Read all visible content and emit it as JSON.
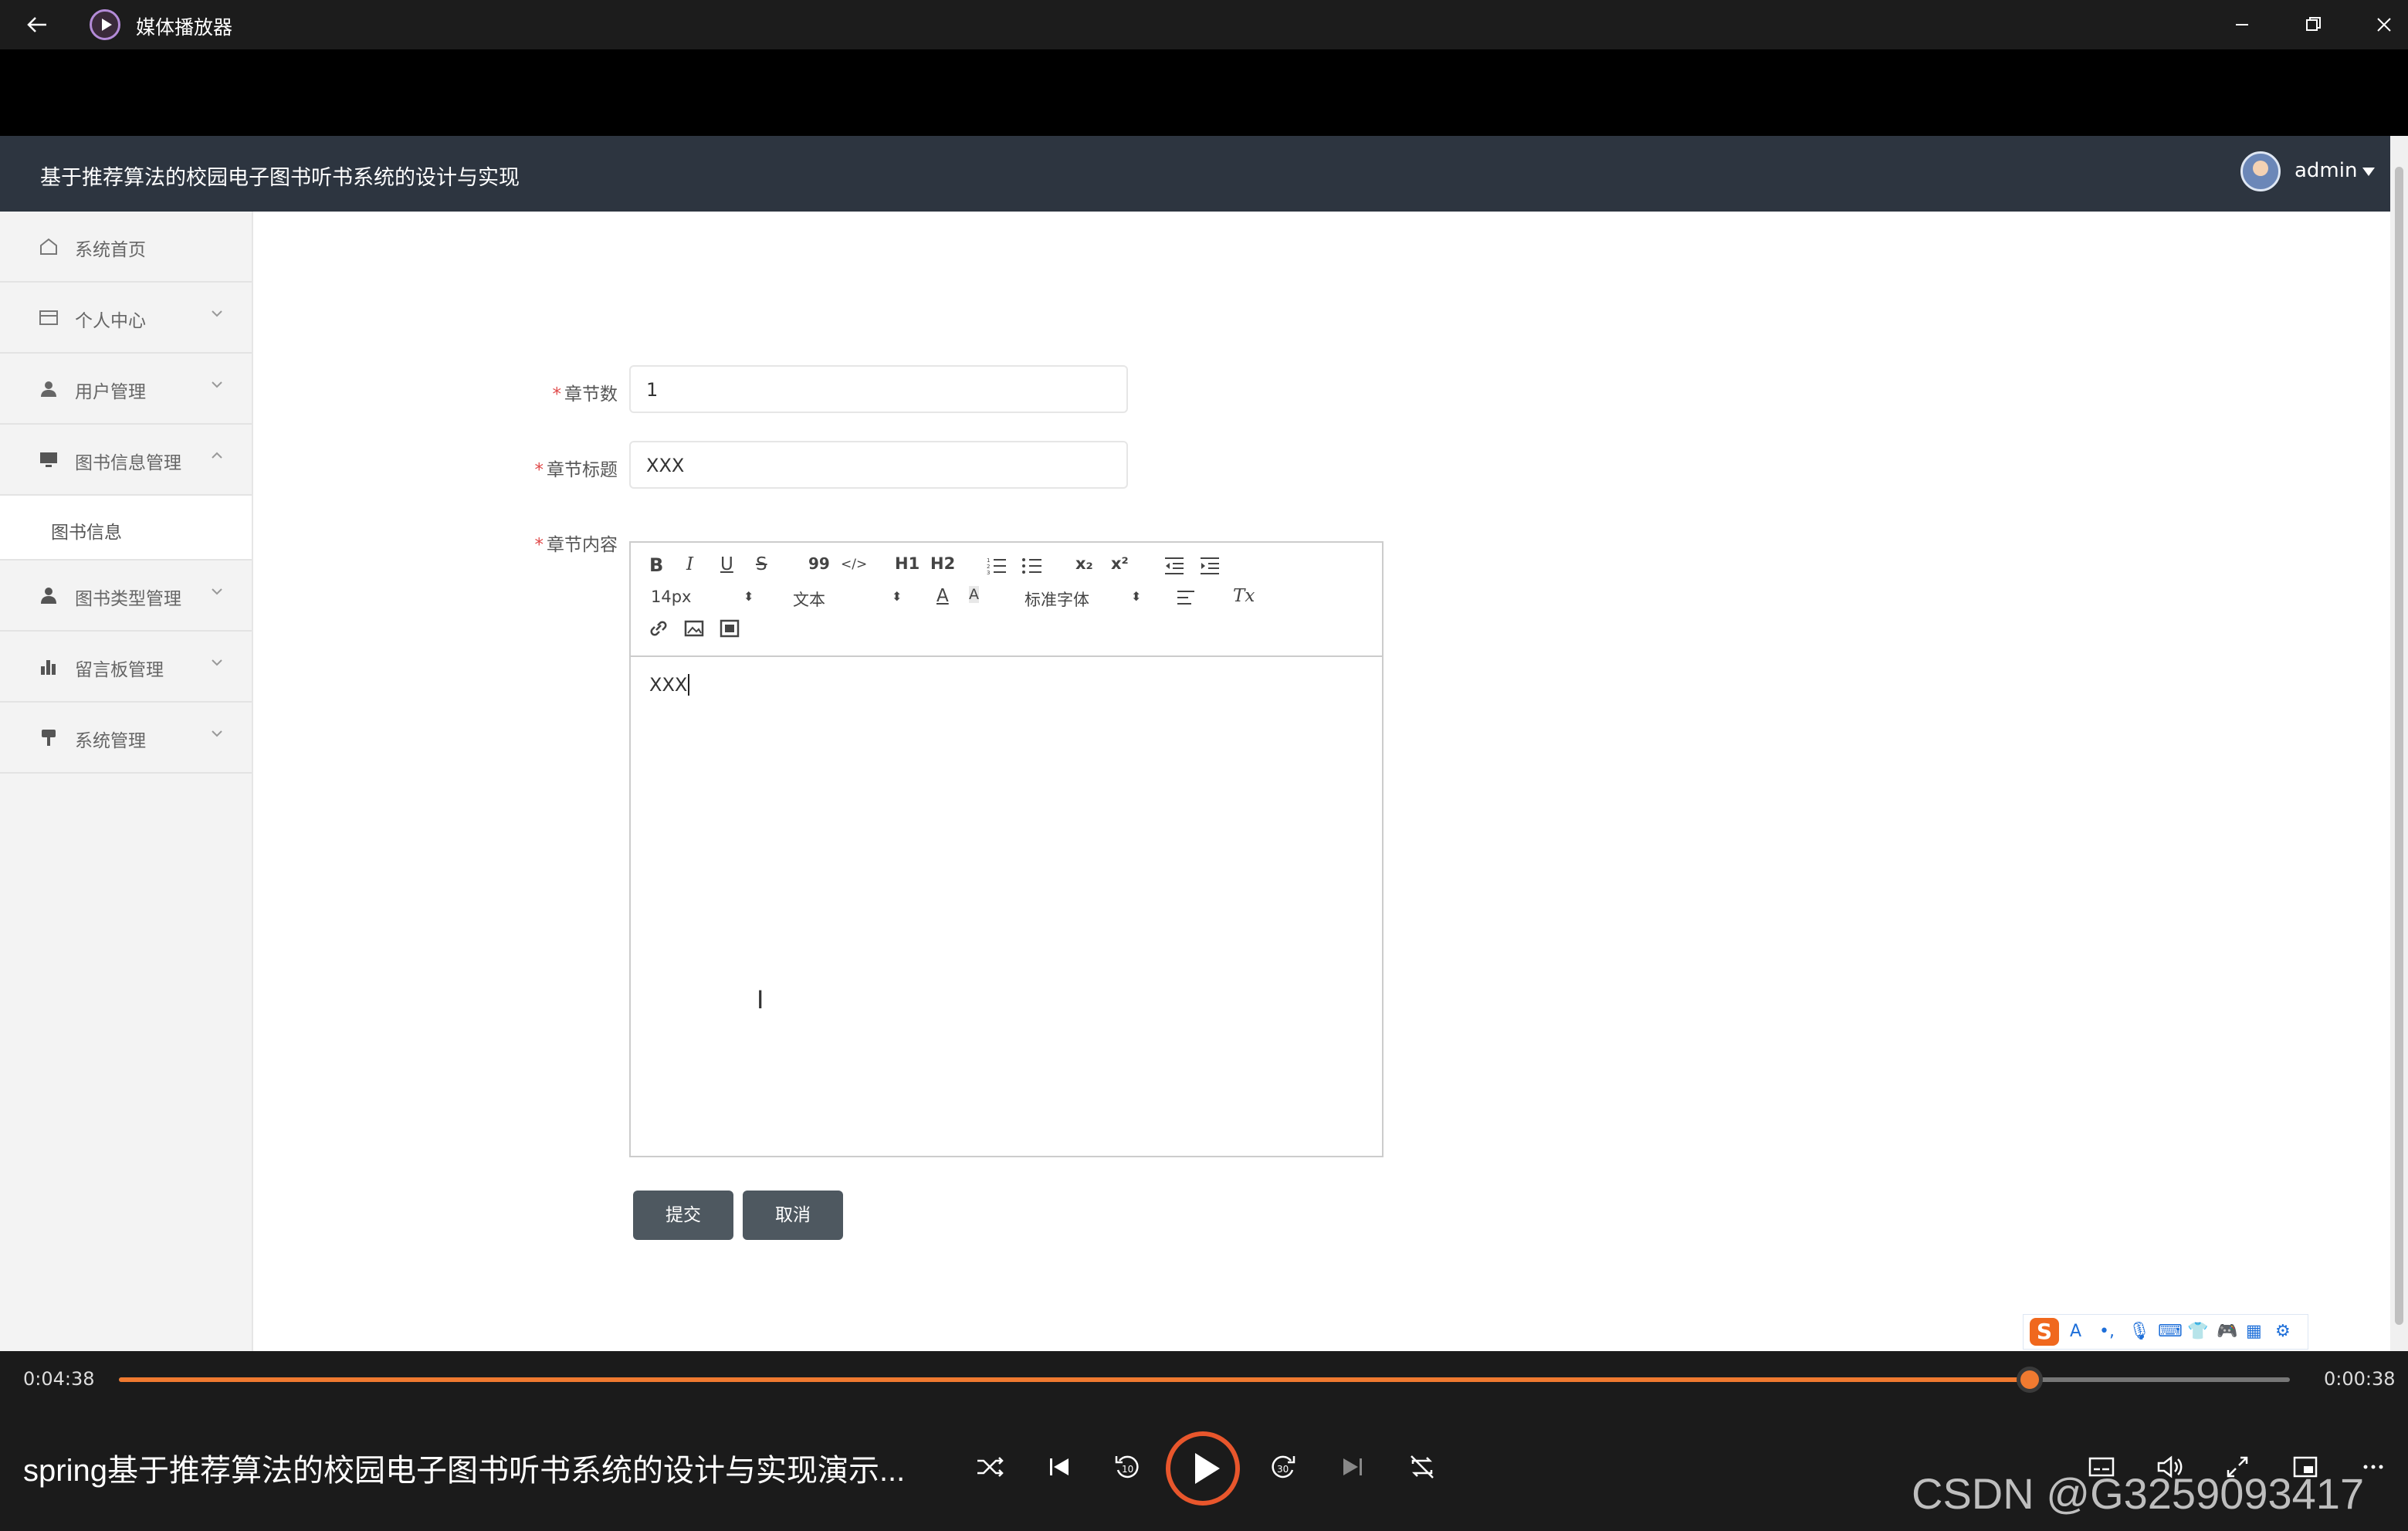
{
  "window": {
    "title": "媒体播放器"
  },
  "header": {
    "title": "基于推荐算法的校园电子图书听书系统的设计与实现",
    "user": "admin"
  },
  "sidebar": {
    "items": [
      {
        "label": "系统首页",
        "icon": "home-icon"
      },
      {
        "label": "个人中心",
        "icon": "card-icon"
      },
      {
        "label": "用户管理",
        "icon": "user-icon"
      },
      {
        "label": "图书信息管理",
        "icon": "monitor-icon",
        "expanded": true
      },
      {
        "label": "图书类型管理",
        "icon": "person-icon"
      },
      {
        "label": "留言板管理",
        "icon": "bar-chart-icon"
      },
      {
        "label": "系统管理",
        "icon": "pin-icon"
      }
    ],
    "subitem": "图书信息"
  },
  "form": {
    "chapter_no_label": "章节数",
    "chapter_no_value": "1",
    "chapter_title_label": "章节标题",
    "chapter_title_value": "XXX",
    "chapter_content_label": "章节内容",
    "content": "XXX",
    "submit": "提交",
    "cancel": "取消"
  },
  "editor": {
    "size": "14px",
    "block": "文本",
    "font": "标准字体",
    "bold": "B",
    "italic": "I",
    "underline": "U",
    "strike": "S",
    "quote": "99",
    "code": "</>",
    "h1": "H1",
    "h2": "H2",
    "sub": "x₂",
    "sup": "x²",
    "clean": "Tx"
  },
  "player": {
    "elapsed": "0:04:38",
    "remaining": "0:00:38",
    "progress": 0.88,
    "title": "spring基于推荐算法的校园电子图书听书系统的设计与实现演示...",
    "watermark": "CSDN @G3259093417",
    "accent": "#f07a30"
  }
}
